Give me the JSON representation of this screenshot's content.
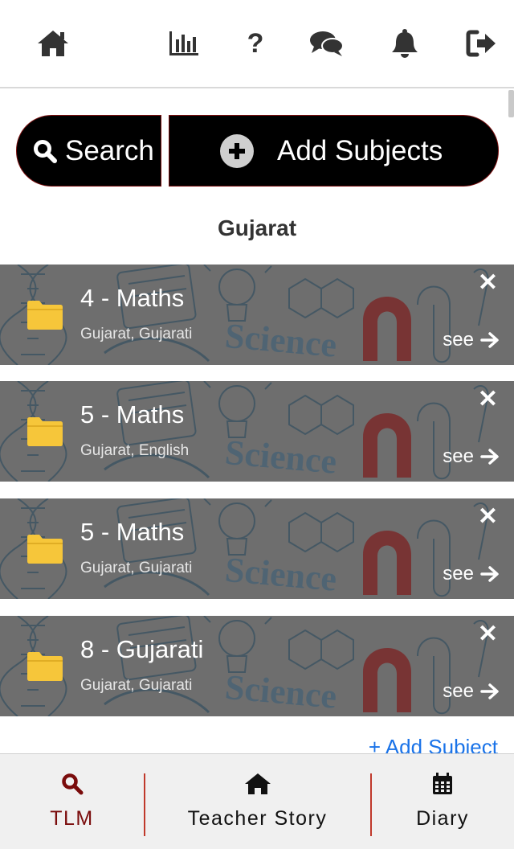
{
  "header": {
    "icons": [
      "home-icon",
      "chart-icon",
      "question-icon",
      "chat-icon",
      "bell-icon",
      "sign-out-icon"
    ],
    "help_glyph": "?"
  },
  "actions": {
    "search_label": "Search",
    "add_subjects_label": "Add Subjects"
  },
  "state_title": "Gujarat",
  "subjects": [
    {
      "title": "4 - Maths",
      "subtitle": "Gujarat, Gujarati",
      "see": "see"
    },
    {
      "title": "5 - Maths",
      "subtitle": "Gujarat, English",
      "see": "see"
    },
    {
      "title": "5 - Maths",
      "subtitle": "Gujarat, Gujarati",
      "see": "see"
    },
    {
      "title": "8 - Gujarati",
      "subtitle": "Gujarat, Gujarati",
      "see": "see"
    }
  ],
  "card_background_text": "Science",
  "add_subject_link": "+ Add Subject",
  "bottom_nav": {
    "items": [
      {
        "label": "TLM",
        "icon": "search-icon",
        "active": true
      },
      {
        "label": "Teacher Story",
        "icon": "home-icon",
        "active": false
      },
      {
        "label": "Diary",
        "icon": "calendar-icon",
        "active": false
      }
    ]
  },
  "colors": {
    "accent": "#7a0c0c",
    "card_overlay": "#6b6b6b",
    "folder": "#f6c63a",
    "link": "#1a73e8"
  }
}
